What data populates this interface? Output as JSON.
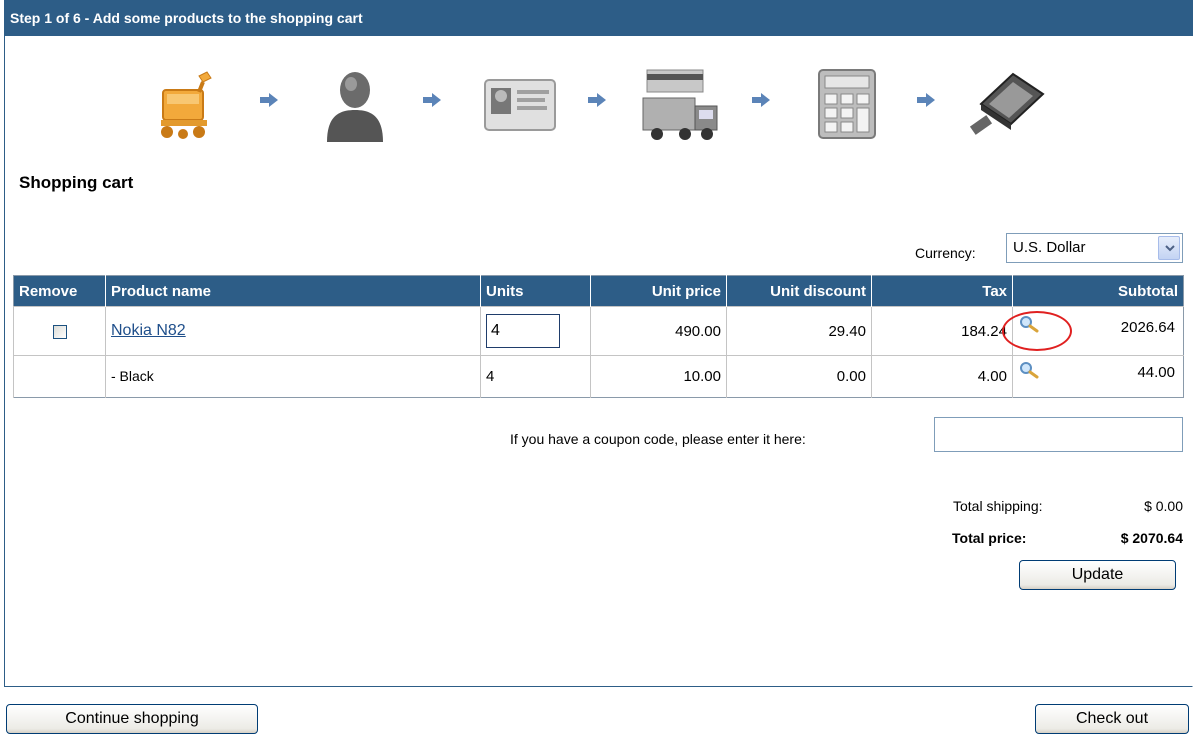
{
  "header": {
    "title": "Step 1 of 6 - Add some products to the shopping cart"
  },
  "steps": [
    {
      "icon": "shopping-cart-icon"
    },
    {
      "icon": "person-icon"
    },
    {
      "icon": "id-card-icon"
    },
    {
      "icon": "delivery-truck-icon"
    },
    {
      "icon": "calculator-icon"
    },
    {
      "icon": "payment-device-icon"
    }
  ],
  "page_title": "Shopping cart",
  "currency": {
    "label": "Currency:",
    "selected": "U.S. Dollar"
  },
  "table": {
    "headers": [
      "Remove",
      "Product name",
      "Units",
      "Unit price",
      "Unit discount",
      "Tax",
      "Subtotal"
    ],
    "rows": [
      {
        "product": "Nokia N82",
        "units": "4",
        "unit_price": "490.00",
        "unit_discount": "29.40",
        "tax": "184.24",
        "subtotal": "2026.64"
      },
      {
        "product": "- Black",
        "units": "4",
        "unit_price": "10.00",
        "unit_discount": "0.00",
        "tax": "4.00",
        "subtotal": "44.00"
      }
    ]
  },
  "coupon": {
    "label": "If you have a coupon code, please enter it here:",
    "value": ""
  },
  "totals": {
    "shipping_label": "Total shipping:",
    "shipping_value": "$ 0.00",
    "price_label": "Total price:",
    "price_value": "$ 2070.64"
  },
  "buttons": {
    "update": "Update",
    "continue": "Continue shopping",
    "checkout": "Check out"
  },
  "colors": {
    "header_bg": "#2d5d87",
    "link": "#1f4f8b",
    "highlight": "#e02020"
  }
}
